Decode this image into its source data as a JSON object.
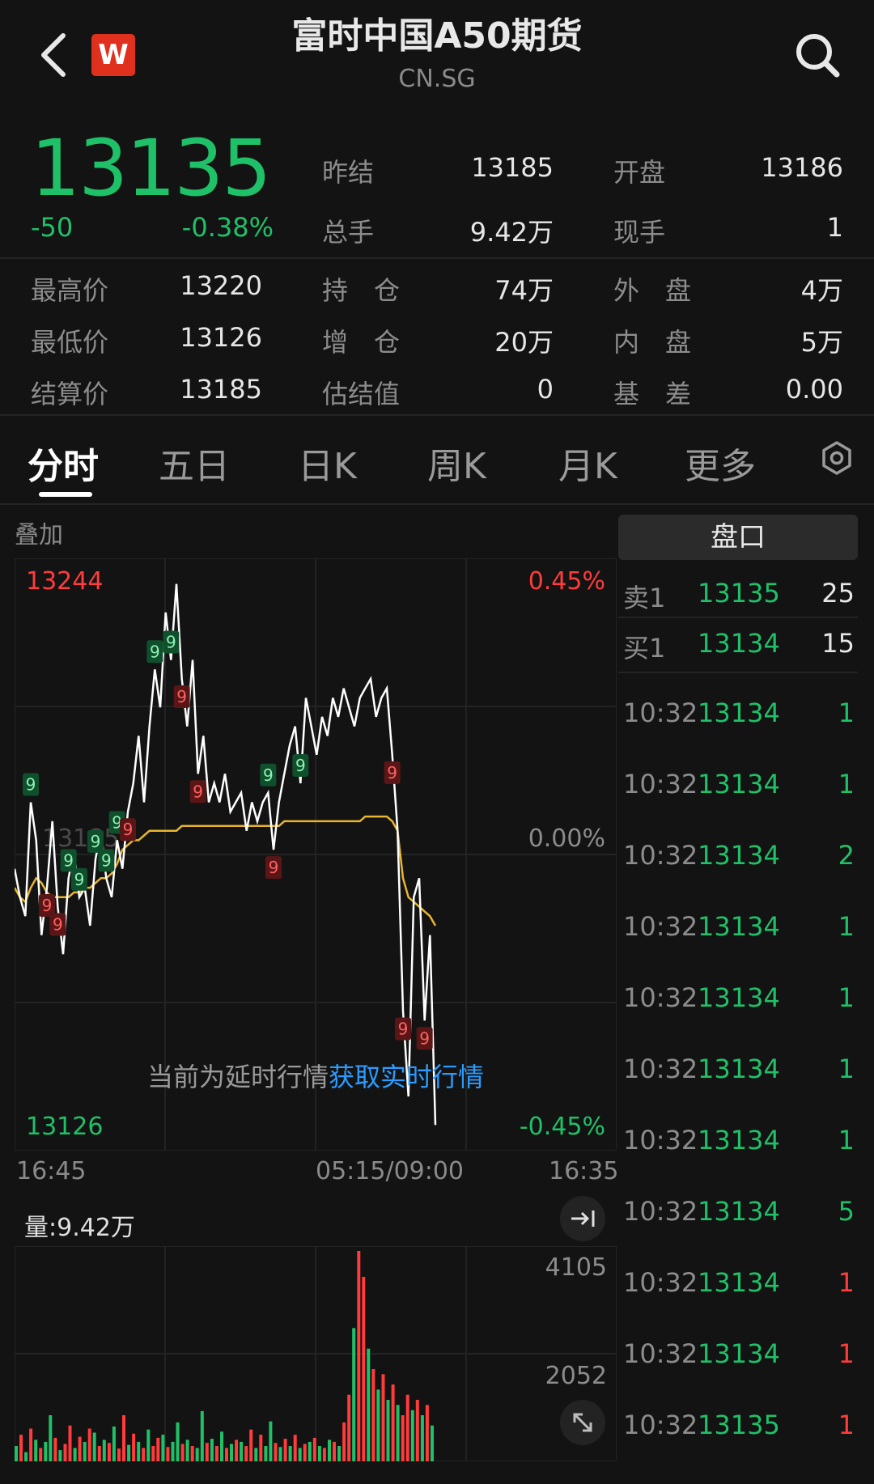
{
  "header": {
    "title": "富时中国A50期货",
    "subtitle": "CN.SG",
    "logo_text": "W"
  },
  "quote": {
    "price": "13135",
    "change": "-50",
    "change_pct": "-0.38%",
    "stats": [
      {
        "label": "昨结",
        "value": "13185"
      },
      {
        "label": "开盘",
        "value": "13186"
      },
      {
        "label": "总手",
        "value": "9.42万"
      },
      {
        "label": "现手",
        "value": "1"
      },
      {
        "label": "最高价",
        "value": "13220"
      },
      {
        "label": "持　仓",
        "value": "74万"
      },
      {
        "label": "外　盘",
        "value": "4万"
      },
      {
        "label": "最低价",
        "value": "13126"
      },
      {
        "label": "增　仓",
        "value": "20万"
      },
      {
        "label": "内　盘",
        "value": "5万"
      },
      {
        "label": "结算价",
        "value": "13185"
      },
      {
        "label": "估结值",
        "value": "0"
      },
      {
        "label": "基　差",
        "value": "0.00"
      }
    ]
  },
  "tabs": [
    "分时",
    "五日",
    "日K",
    "周K",
    "月K",
    "更多"
  ],
  "chart": {
    "overlay_label": "叠加",
    "y_max": "13244",
    "y_min": "13126",
    "pct_max": "0.45%",
    "pct_mid": "0.00%",
    "pct_min": "-0.45%",
    "mid_price_label": "13185",
    "notice_text": "当前为延时行情",
    "notice_link": "获取实时行情",
    "time_start": "16:45",
    "time_mid": "05:15/09:00",
    "time_end": "16:35",
    "volume_label": "量:9.42万",
    "vol_max": "4105",
    "vol_mid": "2052",
    "marker_text": "9",
    "colors": {
      "up": "#ff3b3b",
      "down": "#1fc168",
      "avg": "#e8b62c",
      "line": "#ffffff"
    }
  },
  "chart_data": {
    "type": "line",
    "title": "",
    "xlabel": "",
    "ylabel": "",
    "x_ticks": [
      "16:45",
      "05:15/09:00",
      "16:35"
    ],
    "ylim": [
      13126,
      13244
    ],
    "series": [
      {
        "values": [
          13182,
          13176,
          13172,
          13196,
          13188,
          13168,
          13178,
          13192,
          13174,
          13164,
          13180,
          13186,
          13176,
          13178,
          13170,
          13184,
          13190,
          13180,
          13176,
          13188,
          13182,
          13194,
          13200,
          13210,
          13196,
          13212,
          13224,
          13216,
          13236,
          13226,
          13242,
          13222,
          13212,
          13226,
          13202,
          13210,
          13196,
          13200,
          13196,
          13202,
          13194,
          13196,
          13198,
          13190,
          13196,
          13192,
          13196,
          13198,
          13186,
          13196,
          13202,
          13208,
          13212,
          13200,
          13218,
          13212,
          13206,
          13214,
          13210,
          13218,
          13214,
          13220,
          13216,
          13212,
          13218,
          13220,
          13222,
          13214,
          13218,
          13220,
          13206,
          13190,
          13152,
          13134,
          13176,
          13180,
          13150,
          13168,
          13128
        ]
      },
      {
        "values": [
          13178,
          13176,
          13175,
          13178,
          13180,
          13179,
          13177,
          13176,
          13176,
          13176,
          13176,
          13177,
          13177,
          13178,
          13178,
          13179,
          13180,
          13180,
          13181,
          13183,
          13186,
          13187,
          13188,
          13188,
          13189,
          13190,
          13190,
          13190,
          13190,
          13190,
          13190,
          13191,
          13191,
          13191,
          13191,
          13191,
          13191,
          13191,
          13191,
          13191,
          13191,
          13191,
          13191,
          13191,
          13191,
          13191,
          13191,
          13191,
          13191,
          13191,
          13192,
          13192,
          13192,
          13192,
          13192,
          13192,
          13192,
          13192,
          13192,
          13192,
          13192,
          13192,
          13192,
          13192,
          13192,
          13193,
          13193,
          13193,
          13193,
          13193,
          13192,
          13190,
          13180,
          13176,
          13175,
          13174,
          13173,
          13172,
          13170
        ]
      }
    ]
  },
  "volume_data": {
    "type": "bar",
    "values": [
      300,
      520,
      180,
      640,
      420,
      260,
      380,
      900,
      460,
      220,
      340,
      700,
      260,
      480,
      380,
      640,
      560,
      300,
      420,
      360,
      680,
      250,
      900,
      320,
      540,
      380,
      260,
      620,
      300,
      460,
      520,
      280,
      380,
      760,
      340,
      420,
      300,
      260,
      980,
      360,
      440,
      300,
      580,
      260,
      340,
      420,
      380,
      300,
      620,
      260,
      520,
      300,
      780,
      360,
      280,
      440,
      300,
      520,
      260,
      340,
      380,
      460,
      300,
      260,
      420,
      380,
      300,
      760,
      1300,
      2600,
      4105,
      3600,
      2200,
      1800,
      1400,
      1700,
      1200,
      1500,
      1100,
      900,
      1300,
      1000,
      1200,
      900,
      1100,
      700
    ],
    "directions": [
      "d",
      "u",
      "d",
      "u",
      "d",
      "u",
      "d",
      "d",
      "u",
      "d",
      "u",
      "u",
      "d",
      "u",
      "d",
      "u",
      "d",
      "u",
      "d",
      "u",
      "d",
      "u",
      "u",
      "d",
      "u",
      "d",
      "u",
      "d",
      "u",
      "u",
      "d",
      "u",
      "d",
      "d",
      "u",
      "d",
      "u",
      "d",
      "d",
      "u",
      "d",
      "u",
      "d",
      "u",
      "d",
      "u",
      "d",
      "u",
      "u",
      "d",
      "u",
      "d",
      "d",
      "u",
      "d",
      "u",
      "d",
      "u",
      "d",
      "u",
      "d",
      "u",
      "d",
      "u",
      "d",
      "u",
      "d",
      "u",
      "u",
      "d",
      "u",
      "u",
      "d",
      "u",
      "d",
      "u",
      "d",
      "u",
      "d",
      "u",
      "u",
      "d",
      "u",
      "d",
      "u",
      "d"
    ]
  },
  "order_book": {
    "panel_label": "盘口",
    "sell": {
      "label": "卖1",
      "price": "13135",
      "qty": "25"
    },
    "buy": {
      "label": "买1",
      "price": "13134",
      "qty": "15"
    }
  },
  "ticks": [
    {
      "time": "10:32",
      "price": "13134",
      "qty": "1",
      "dir": "down"
    },
    {
      "time": "10:32",
      "price": "13134",
      "qty": "1",
      "dir": "down"
    },
    {
      "time": "10:32",
      "price": "13134",
      "qty": "2",
      "dir": "down"
    },
    {
      "time": "10:32",
      "price": "13134",
      "qty": "1",
      "dir": "down"
    },
    {
      "time": "10:32",
      "price": "13134",
      "qty": "1",
      "dir": "down"
    },
    {
      "time": "10:32",
      "price": "13134",
      "qty": "1",
      "dir": "down"
    },
    {
      "time": "10:32",
      "price": "13134",
      "qty": "1",
      "dir": "down"
    },
    {
      "time": "10:32",
      "price": "13134",
      "qty": "5",
      "dir": "down"
    },
    {
      "time": "10:32",
      "price": "13134",
      "qty": "1",
      "dir": "up"
    },
    {
      "time": "10:32",
      "price": "13134",
      "qty": "1",
      "dir": "up"
    },
    {
      "time": "10:32",
      "price": "13135",
      "qty": "1",
      "dir": "up"
    }
  ]
}
